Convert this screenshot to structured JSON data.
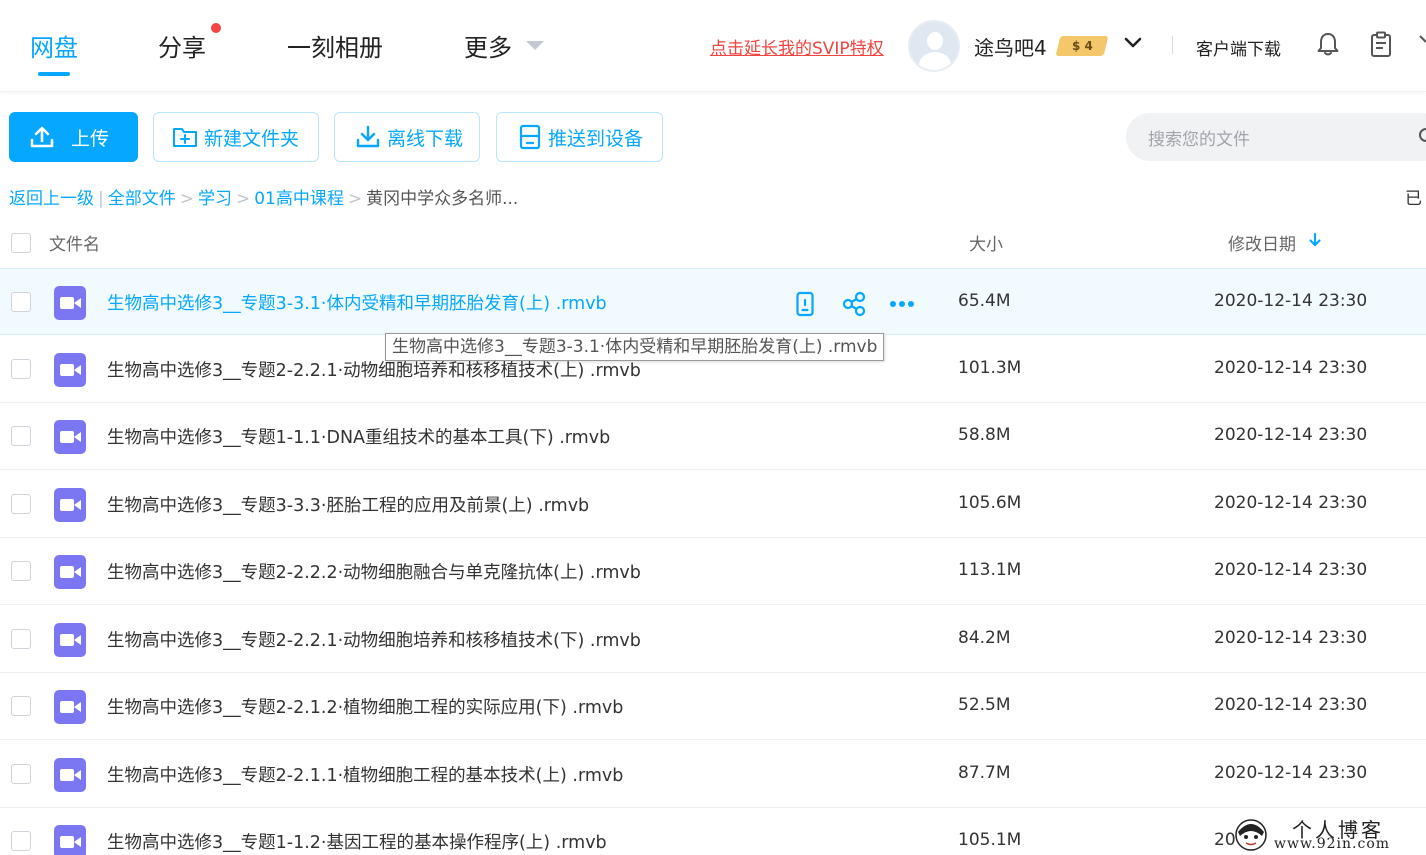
{
  "nav": {
    "tabs": [
      "网盘",
      "分享",
      "一刻相册",
      "更多"
    ],
    "active_index": 0
  },
  "header": {
    "svip_link": "点击延长我的SVIP特权",
    "username": "途鸟吧4",
    "level_badge": "$ 4",
    "client_download": "客户端下载",
    "icons": [
      "chevron-down-icon",
      "bell-icon",
      "clipboard-icon"
    ]
  },
  "toolbar": {
    "upload": "上传",
    "new_folder": "新建文件夹",
    "offline_download": "离线下载",
    "push_to_device": "推送到设备",
    "search_placeholder": "搜索您的文件"
  },
  "breadcrumb": {
    "back": "返回上一级",
    "items": [
      "全部文件",
      "学习",
      "01高中课程"
    ],
    "current": "黄冈中学众多名师...",
    "right_text": "已"
  },
  "table": {
    "columns": {
      "name": "文件名",
      "size": "大小",
      "date": "修改日期"
    },
    "rows": [
      {
        "name": "生物高中选修3__专题3-3.1·体内受精和早期胚胎发育(上) .rmvb",
        "size": "65.4M",
        "date": "2020-12-14 23:30"
      },
      {
        "name": "生物高中选修3__专题2-2.2.1·动物细胞培养和核移植技术(上) .rmvb",
        "size": "101.3M",
        "date": "2020-12-14 23:30"
      },
      {
        "name": "生物高中选修3__专题1-1.1·DNA重组技术的基本工具(下) .rmvb",
        "size": "58.8M",
        "date": "2020-12-14 23:30"
      },
      {
        "name": "生物高中选修3__专题3-3.3·胚胎工程的应用及前景(上) .rmvb",
        "size": "105.6M",
        "date": "2020-12-14 23:30"
      },
      {
        "name": "生物高中选修3__专题2-2.2.2·动物细胞融合与单克隆抗体(上) .rmvb",
        "size": "113.1M",
        "date": "2020-12-14 23:30"
      },
      {
        "name": "生物高中选修3__专题2-2.2.1·动物细胞培养和核移植技术(下) .rmvb",
        "size": "84.2M",
        "date": "2020-12-14 23:30"
      },
      {
        "name": "生物高中选修3__专题2-2.1.2·植物细胞工程的实际应用(下) .rmvb",
        "size": "52.5M",
        "date": "2020-12-14 23:30"
      },
      {
        "name": "生物高中选修3__专题2-2.1.1·植物细胞工程的基本技术(上) .rmvb",
        "size": "87.7M",
        "date": "2020-12-14 23:30"
      },
      {
        "name": "生物高中选修3__专题1-1.2·基因工程的基本操作程序(上) .rmvb",
        "size": "105.1M",
        "date": "20"
      }
    ]
  },
  "tooltip": "生物高中选修3__专题3-3.1·体内受精和早期胚胎发育(上) .rmvb",
  "watermark": {
    "text": "个人博客",
    "url": "www.92in.com"
  },
  "colors": {
    "accent": "#06a7ff",
    "danger": "#f2433f",
    "video_icon": "#7b77f3"
  }
}
